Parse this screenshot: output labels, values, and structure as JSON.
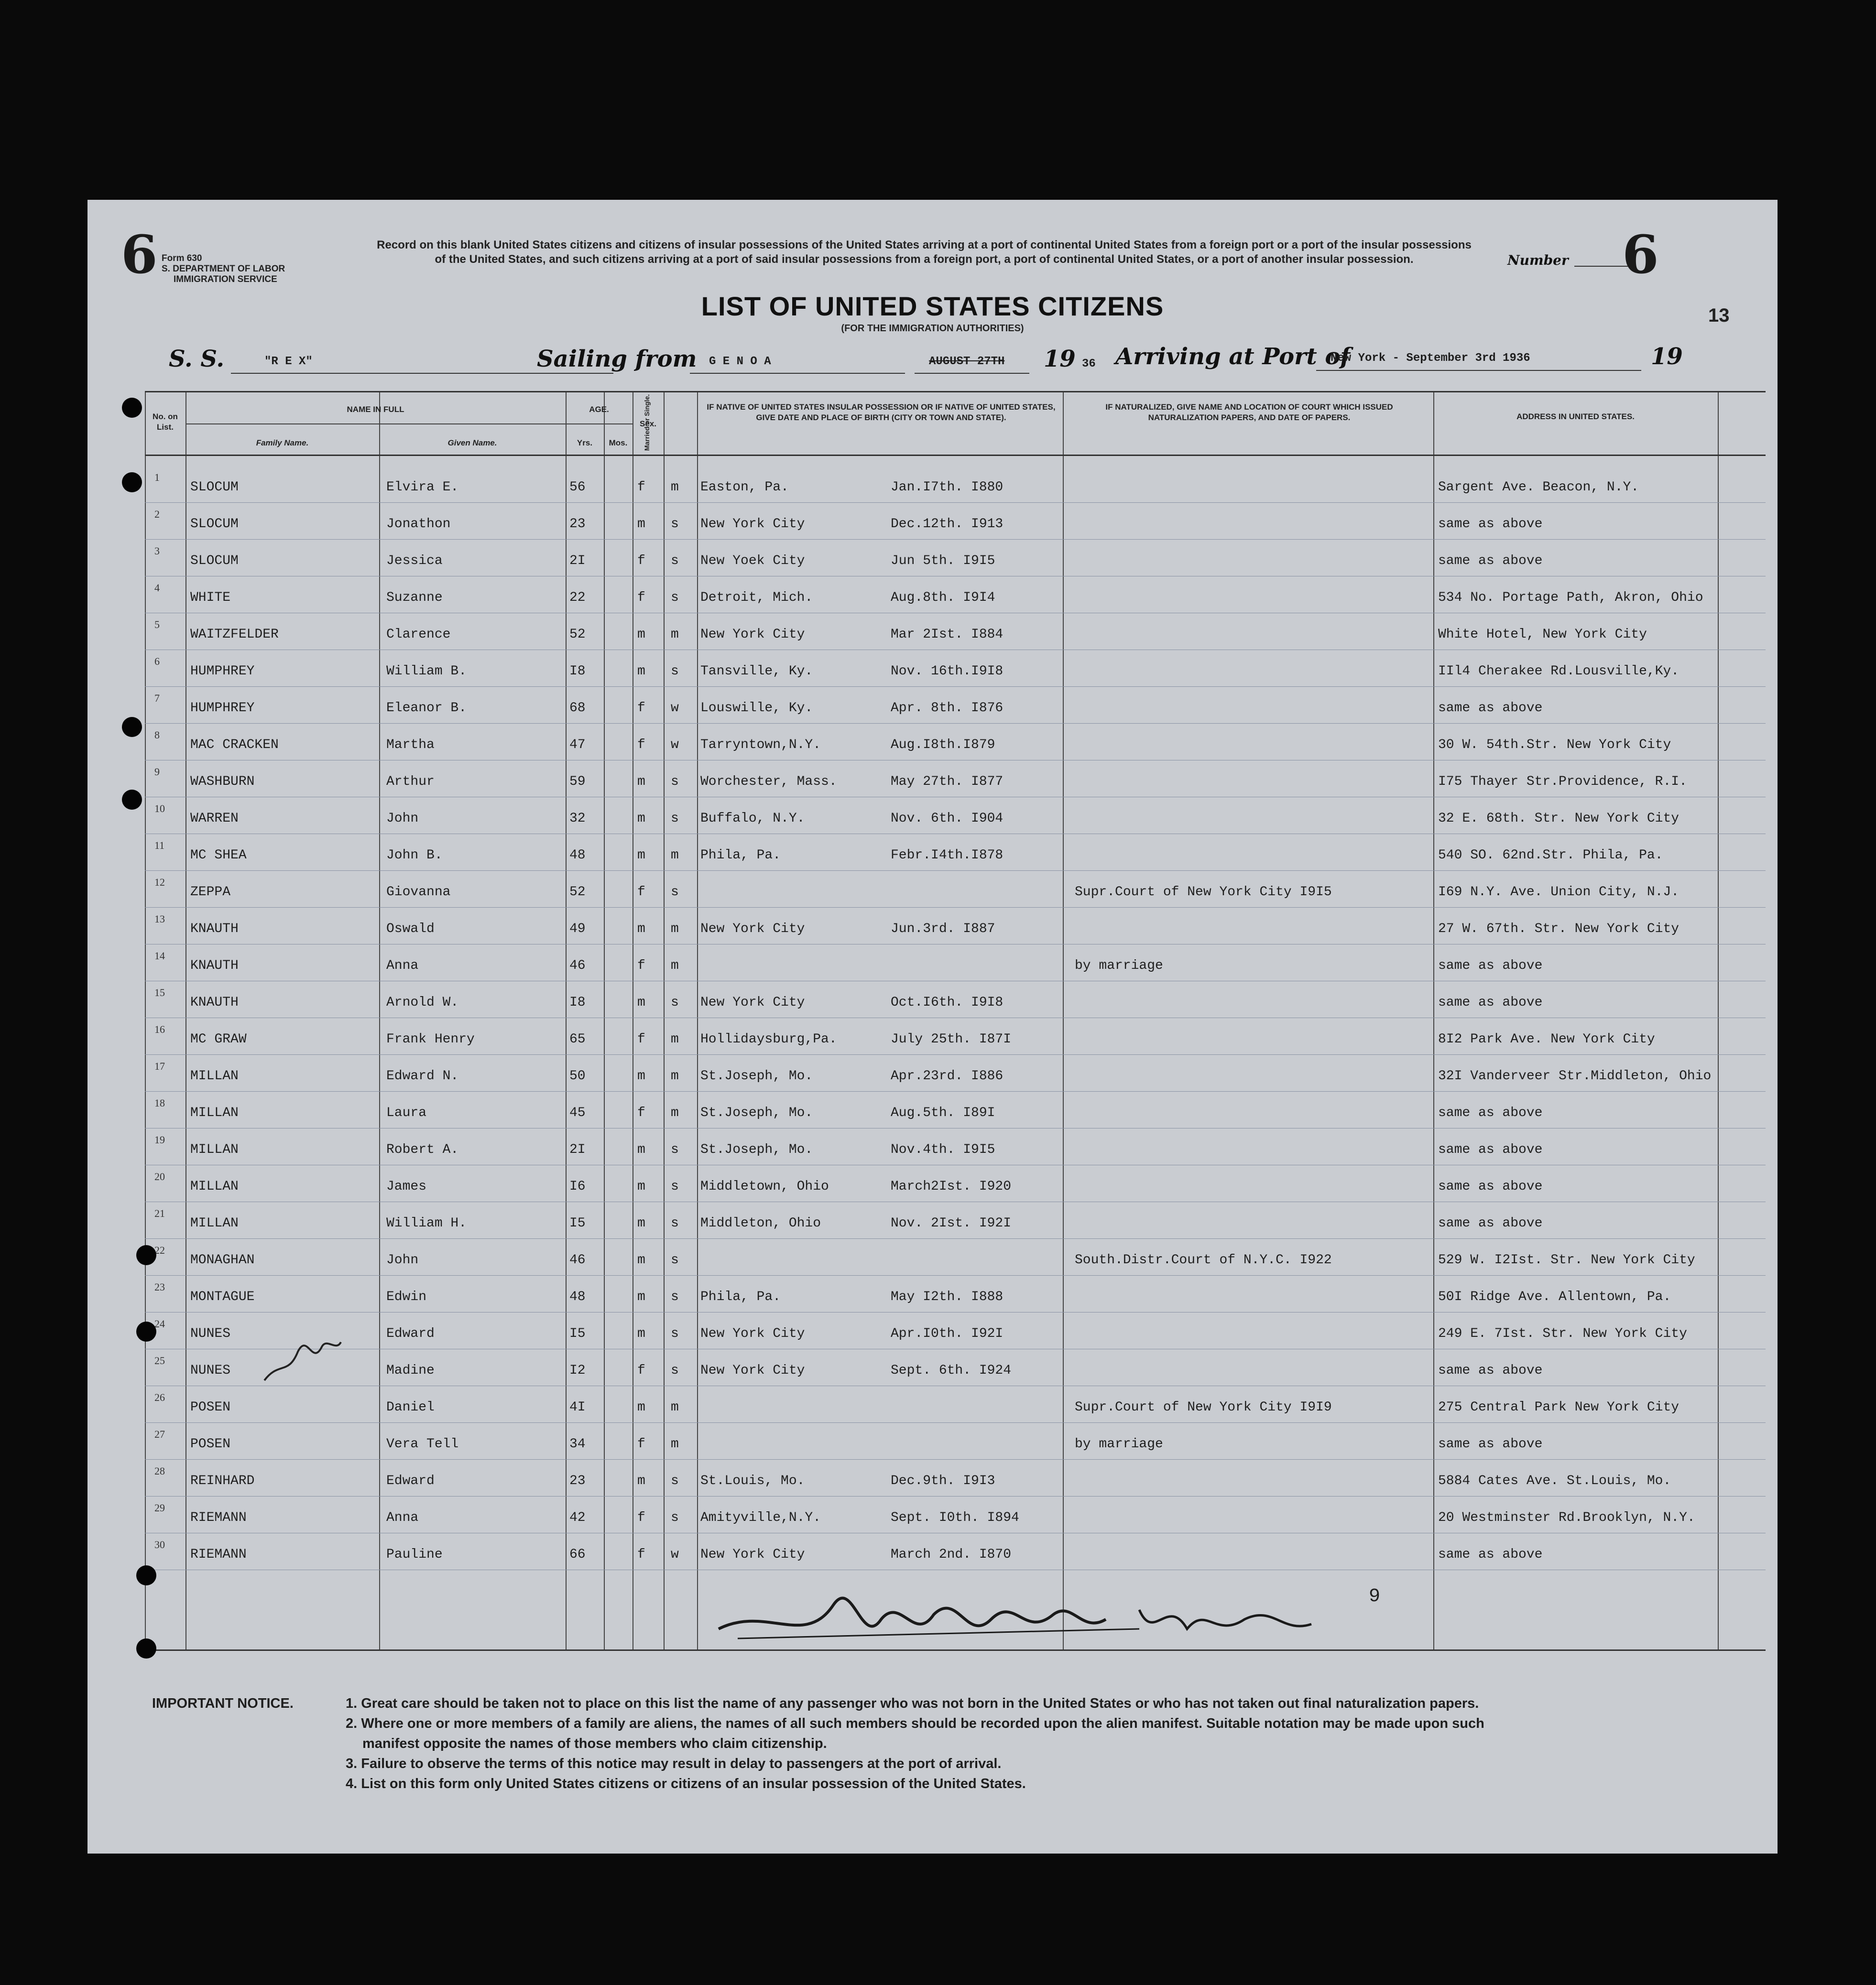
{
  "form": {
    "number_left": "6",
    "form_label": "Form 630",
    "dept": "S. DEPARTMENT OF LABOR",
    "service": "IMMIGRATION SERVICE",
    "instructions": "Record on this blank United States citizens and citizens of insular possessions of the United States arriving at a port of continental United States from a foreign port or a port of the insular possessions of the United States, and such citizens arriving at a port of said insular possessions from a foreign port, a port of continental United States, or a port of another insular possession.",
    "number_label": "Number",
    "number_right": "6",
    "title": "LIST OF UNITED STATES CITIZENS",
    "subtitle": "(FOR THE IMMIGRATION AUTHORITIES)",
    "page_number": "13",
    "ss_label": "S. S.",
    "ship": "\"R E X\"",
    "sailing_label": "Sailing from",
    "port_from": "G E N O A",
    "sail_date": "AUGUST 27TH",
    "year_prefix": "19",
    "year_suffix": "36",
    "arriving_label": "Arriving at Port of",
    "port_to": "New York - September 3rd 1936",
    "year_prefix2": "19"
  },
  "headers": {
    "no_on_list": "No. on List.",
    "name_in_full": "NAME IN FULL",
    "family_name": "Family Name.",
    "given_name": "Given Name.",
    "age": "AGE.",
    "yrs": "Yrs.",
    "mos": "Mos.",
    "sex": "Sex.",
    "married": "Married or Single.",
    "birth": "IF NATIVE OF UNITED STATES INSULAR POSSESSION OR IF NATIVE OF UNITED STATES, GIVE DATE AND PLACE OF BIRTH (CITY OR TOWN AND STATE).",
    "naturalized": "IF NATURALIZED, GIVE NAME AND LOCATION OF COURT WHICH ISSUED NATURALIZATION PAPERS, AND DATE OF PAPERS.",
    "address": "ADDRESS IN UNITED STATES."
  },
  "rows": [
    {
      "no": "1",
      "family": "SLOCUM",
      "given": "Elvira E.",
      "age": "56",
      "sex": "f",
      "marital": "m",
      "place": "Easton, Pa.",
      "date": "Jan.I7th. I880",
      "court": "",
      "address": "Sargent Ave. Beacon, N.Y."
    },
    {
      "no": "2",
      "family": "SLOCUM",
      "given": "Jonathon",
      "age": "23",
      "sex": "m",
      "marital": "s",
      "place": "New York City",
      "date": "Dec.12th. I913",
      "court": "",
      "address": "same  as  above"
    },
    {
      "no": "3",
      "family": "SLOCUM",
      "given": "Jessica",
      "age": "2I",
      "sex": "f",
      "marital": "s",
      "place": "New Yoek City",
      "date": "Jun 5th. I9I5",
      "court": "",
      "address": "same  as  above"
    },
    {
      "no": "4",
      "family": "WHITE",
      "given": "Suzanne",
      "age": "22",
      "sex": "f",
      "marital": "s",
      "place": "Detroit, Mich.",
      "date": "Aug.8th. I9I4",
      "court": "",
      "address": "534 No. Portage Path, Akron, Ohio"
    },
    {
      "no": "5",
      "family": "WAITZFELDER",
      "given": "Clarence",
      "age": "52",
      "sex": "m",
      "marital": "m",
      "place": "New York City",
      "date": "Mar 2Ist. I884",
      "court": "",
      "address": "White Hotel, New York City"
    },
    {
      "no": "6",
      "family": "HUMPHREY",
      "given": "William B.",
      "age": "I8",
      "sex": "m",
      "marital": "s",
      "place": "Tansville, Ky.",
      "date": "Nov. 16th.I9I8",
      "court": "",
      "address": "IIl4 Cherakee Rd.Lousville,Ky."
    },
    {
      "no": "7",
      "family": "HUMPHREY",
      "given": "Eleanor B.",
      "age": "68",
      "sex": "f",
      "marital": "w",
      "place": "Louswille, Ky.",
      "date": "Apr. 8th. I876",
      "court": "",
      "address": "same  as  above"
    },
    {
      "no": "8",
      "family": "MAC CRACKEN",
      "given": "Martha",
      "age": "47",
      "sex": "f",
      "marital": "w",
      "place": "Tarryntown,N.Y.",
      "date": "Aug.I8th.I879",
      "court": "",
      "address": "30 W. 54th.Str. New York City"
    },
    {
      "no": "9",
      "family": "WASHBURN",
      "given": "Arthur",
      "age": "59",
      "sex": "m",
      "marital": "s",
      "place": "Worchester, Mass.",
      "date": "May 27th. I877",
      "court": "",
      "address": "I75 Thayer Str.Providence, R.I."
    },
    {
      "no": "10",
      "family": "WARREN",
      "given": "John",
      "age": "32",
      "sex": "m",
      "marital": "s",
      "place": "Buffalo, N.Y.",
      "date": "Nov. 6th. I904",
      "court": "",
      "address": "32 E. 68th. Str. New York City"
    },
    {
      "no": "11",
      "family": "MC SHEA",
      "given": "John B.",
      "age": "48",
      "sex": "m",
      "marital": "m",
      "place": "Phila, Pa.",
      "date": "Febr.I4th.I878",
      "court": "",
      "address": "540 SO. 62nd.Str. Phila, Pa."
    },
    {
      "no": "12",
      "family": "ZEPPA",
      "given": "Giovanna",
      "age": "52",
      "sex": "f",
      "marital": "s",
      "place": "",
      "date": "",
      "court": "Supr.Court of New York City I9I5",
      "address": "I69 N.Y. Ave. Union City, N.J."
    },
    {
      "no": "13",
      "family": "KNAUTH",
      "given": "Oswald",
      "age": "49",
      "sex": "m",
      "marital": "m",
      "place": "New York City",
      "date": "Jun.3rd. I887",
      "court": "",
      "address": "27 W. 67th. Str. New York City"
    },
    {
      "no": "14",
      "family": "KNAUTH",
      "given": "Anna",
      "age": "46",
      "sex": "f",
      "marital": "m",
      "place": "",
      "date": "",
      "court": "by marriage",
      "address": "same  as  above"
    },
    {
      "no": "15",
      "family": "KNAUTH",
      "given": "Arnold W.",
      "age": "I8",
      "sex": "m",
      "marital": "s",
      "place": "New York City",
      "date": "Oct.I6th. I9I8",
      "court": "",
      "address": "same  as  above"
    },
    {
      "no": "16",
      "family": "MC GRAW",
      "given": "Frank Henry",
      "age": "65",
      "sex": "f",
      "marital": "m",
      "place": "Hollidaysburg,Pa.",
      "date": "July 25th. I87I",
      "court": "",
      "address": "8I2 Park Ave. New York City"
    },
    {
      "no": "17",
      "family": "MILLAN",
      "given": "Edward N.",
      "age": "50",
      "sex": "m",
      "marital": "m",
      "place": "St.Joseph, Mo.",
      "date": "Apr.23rd. I886",
      "court": "",
      "address": "32I Vanderveer Str.Middleton, Ohio"
    },
    {
      "no": "18",
      "family": "MILLAN",
      "given": "Laura",
      "age": "45",
      "sex": "f",
      "marital": "m",
      "place": "St.Joseph, Mo.",
      "date": "Aug.5th. I89I",
      "court": "",
      "address": "same  as  above"
    },
    {
      "no": "19",
      "family": "MILLAN",
      "given": "Robert A.",
      "age": "2I",
      "sex": "m",
      "marital": "s",
      "place": "St.Joseph, Mo.",
      "date": "Nov.4th. I9I5",
      "court": "",
      "address": "same  as  above"
    },
    {
      "no": "20",
      "family": "MILLAN",
      "given": "James",
      "age": "I6",
      "sex": "m",
      "marital": "s",
      "place": "Middletown, Ohio",
      "date": "March2Ist. I920",
      "court": "",
      "address": "same  as  above"
    },
    {
      "no": "21",
      "family": "MILLAN",
      "given": "William H.",
      "age": "I5",
      "sex": "m",
      "marital": "s",
      "place": "Middleton, Ohio",
      "date": "Nov. 2Ist. I92I",
      "court": "",
      "address": "same  as above"
    },
    {
      "no": "22",
      "family": "MONAGHAN",
      "given": "John",
      "age": "46",
      "sex": "m",
      "marital": "s",
      "place": "",
      "date": "",
      "court": "South.Distr.Court of N.Y.C. I922",
      "address": "529 W. I2Ist. Str. New York City"
    },
    {
      "no": "23",
      "family": "MONTAGUE",
      "given": "Edwin",
      "age": "48",
      "sex": "m",
      "marital": "s",
      "place": "Phila, Pa.",
      "date": "May I2th. I888",
      "court": "",
      "address": "50I Ridge Ave. Allentown, Pa."
    },
    {
      "no": "24",
      "family": "NUNES",
      "given": "Edward",
      "age": "I5",
      "sex": "m",
      "marital": "s",
      "place": "New York City",
      "date": "Apr.I0th. I92I",
      "court": "",
      "address": "249 E. 7Ist. Str. New York City"
    },
    {
      "no": "25",
      "family": "NUNES",
      "given": "Madine",
      "age": "I2",
      "sex": "f",
      "marital": "s",
      "place": "New York City",
      "date": "Sept. 6th. I924",
      "court": "",
      "address": "same  as  above"
    },
    {
      "no": "26",
      "family": "POSEN",
      "given": "Daniel",
      "age": "4I",
      "sex": "m",
      "marital": "m",
      "place": "",
      "date": "",
      "court": "Supr.Court of New York City I9I9",
      "address": "275 Central Park New York City"
    },
    {
      "no": "27",
      "family": "POSEN",
      "given": "Vera Tell",
      "age": "34",
      "sex": "f",
      "marital": "m",
      "place": "",
      "date": "",
      "court": "by marriage",
      "address": "same  as  above"
    },
    {
      "no": "28",
      "family": "REINHARD",
      "given": "Edward",
      "age": "23",
      "sex": "m",
      "marital": "s",
      "place": "St.Louis, Mo.",
      "date": "Dec.9th. I9I3",
      "court": "",
      "address": "5884 Cates Ave. St.Louis, Mo."
    },
    {
      "no": "29",
      "family": "RIEMANN",
      "given": "Anna",
      "age": "42",
      "sex": "f",
      "marital": "s",
      "place": "Amityville,N.Y.",
      "date": "Sept. I0th. I894",
      "court": "",
      "address": "20 Westminster Rd.Brooklyn, N.Y."
    },
    {
      "no": "30",
      "family": "RIEMANN",
      "given": "Pauline",
      "age": "66",
      "sex": "f",
      "marital": "w",
      "place": "New York City",
      "date": "March 2nd. I870",
      "court": "",
      "address": "same  as  above"
    }
  ],
  "annotations": {
    "margin_note": "Nat 8/46",
    "signature_note": "Insp. 9",
    "count": "9"
  },
  "notice": {
    "label": "IMPORTANT NOTICE.",
    "items": [
      "1. Great care should be taken not to place on this list the name of any passenger who was not born in the United States or who has not taken out final naturalization papers.",
      "2. Where one or more members of a family are aliens, the names of all such members should be recorded upon the alien manifest.  Suitable notation may be made upon such",
      "manifest opposite the names of those members who claim citizenship.",
      "3. Failure to observe the terms of this notice may result in delay to passengers at the port of arrival.",
      "4. List on this form only United States citizens or citizens of an insular possession of the United States."
    ]
  }
}
